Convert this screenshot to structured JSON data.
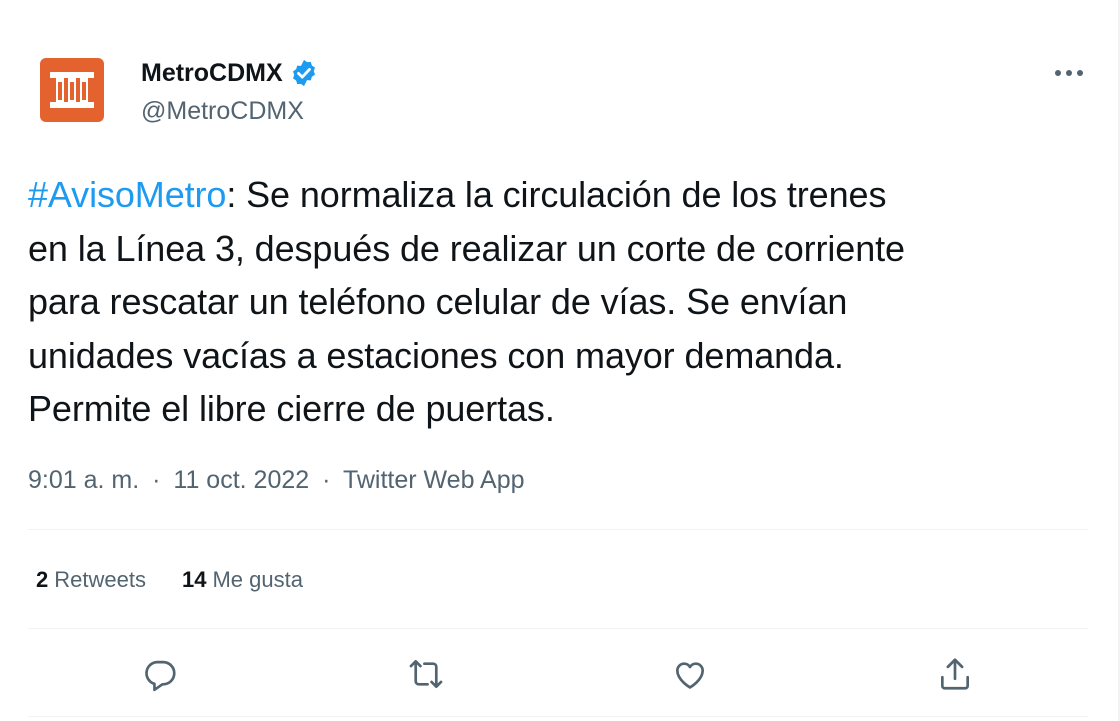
{
  "author": {
    "name": "MetroCDMX",
    "handle": "@MetroCDMX",
    "verified": true,
    "avatar_color": "#e4622d"
  },
  "tweet": {
    "hashtag": "#AvisoMetro",
    "text_lines": [
      ": Se normaliza la circulación de los trenes",
      "en la Línea 3, después de realizar un corte de corriente",
      "para rescatar un teléfono celular de vías. Se envían",
      "unidades vacías a estaciones con mayor demanda.",
      "Permite el libre cierre de puertas."
    ]
  },
  "meta": {
    "time": "9:01 a. m.",
    "separator": "·",
    "date": "11 oct. 2022",
    "source": "Twitter Web App"
  },
  "stats": {
    "retweets_count": "2",
    "retweets_label": "Retweets",
    "likes_count": "14",
    "likes_label": "Me gusta"
  },
  "actions": [
    "reply-icon",
    "retweet-icon",
    "like-icon",
    "share-icon"
  ],
  "colors": {
    "link": "#1d9bf0",
    "secondary_text": "#536471",
    "primary_text": "#0f1419",
    "divider": "#eff3f4",
    "verified": "#1d9bf0"
  }
}
